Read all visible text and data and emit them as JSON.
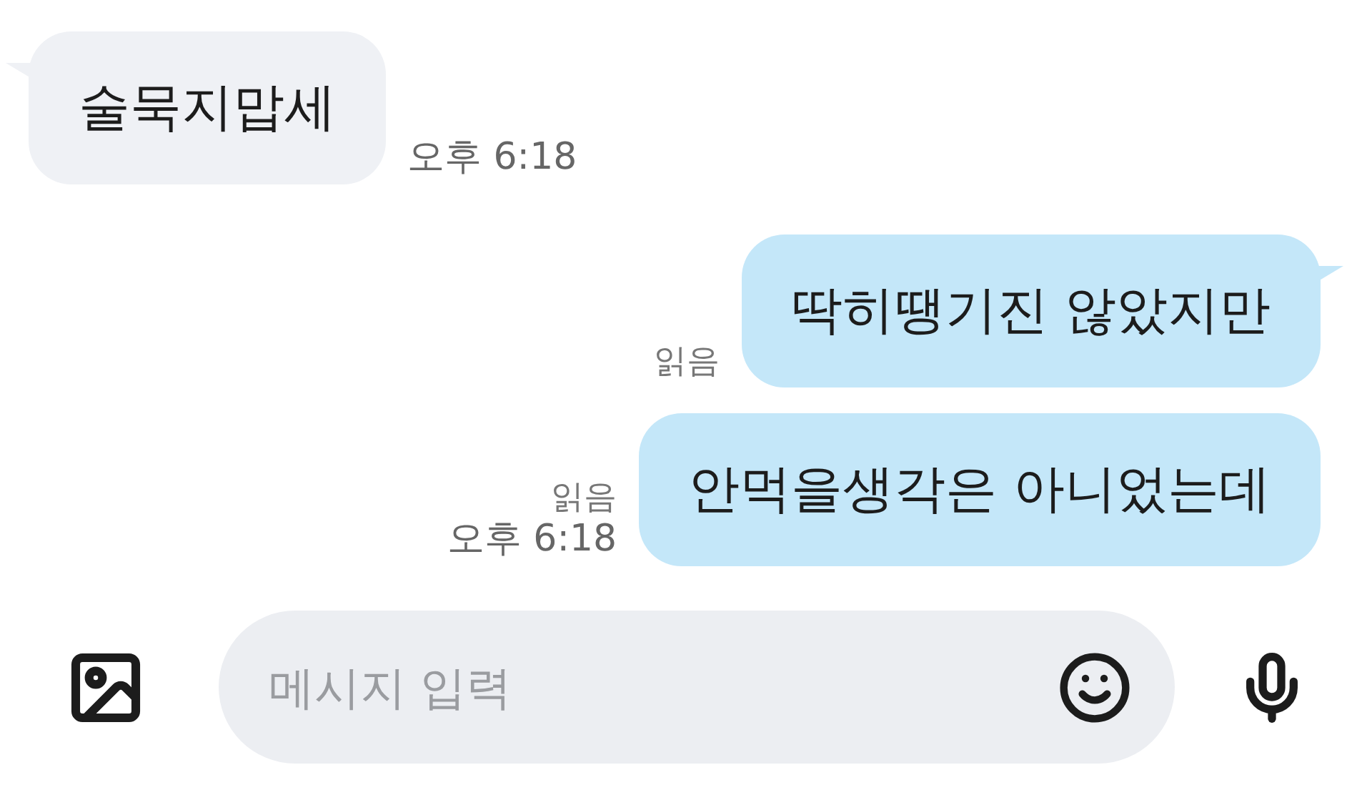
{
  "messages": [
    {
      "kind": "incoming",
      "tail": true,
      "text": "술묵지맙세",
      "time": "오후 6:18"
    },
    {
      "kind": "outgoing",
      "tail": true,
      "text": "딱히땡기진 않았지만",
      "read": "읽음"
    },
    {
      "kind": "outgoing",
      "tail": false,
      "text": "안먹을생각은 아니었는데",
      "read": "읽음",
      "time": "오후 6:18"
    }
  ],
  "composer": {
    "placeholder": "메시지 입력"
  }
}
